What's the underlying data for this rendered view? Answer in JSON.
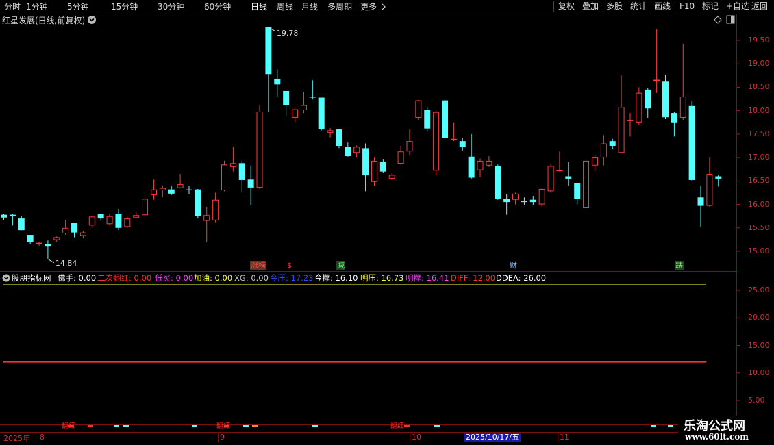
{
  "toolbar": {
    "periods": [
      "分时",
      "1分钟",
      "5分钟",
      "15分钟",
      "30分钟",
      "60分钟",
      "日线",
      "周线",
      "月线",
      "多周期",
      "更多"
    ],
    "active_period": "日线",
    "right_buttons": [
      "复权",
      "叠加",
      "多股",
      "统计",
      "画线",
      "F10",
      "标记",
      "+自选",
      "返回"
    ]
  },
  "chart_header": {
    "title": "红星发展(日线,前复权)"
  },
  "price_axis": {
    "ticks": [
      "19.50",
      "19.00",
      "18.50",
      "18.00",
      "17.50",
      "17.00",
      "16.50",
      "16.00",
      "15.50",
      "15.00"
    ]
  },
  "annotations": {
    "high_label": "19.78",
    "low_label": "14.84"
  },
  "signals": [
    {
      "text": "涨榜",
      "color": "#ff5050",
      "bg": "#663322"
    },
    {
      "text": "$",
      "color": "#ff3030",
      "bg": ""
    },
    {
      "text": "减",
      "color": "#60ff60",
      "bg": "#224422"
    },
    {
      "text": "财",
      "color": "#80c0ff",
      "bg": ""
    },
    {
      "text": "跌",
      "color": "#60ff60",
      "bg": "#224422"
    }
  ],
  "indicator": {
    "name": "股朋指标网",
    "items": [
      {
        "label": "佛手",
        "value": "0.00",
        "color": "#ffffff"
      },
      {
        "label": "二次翻红",
        "value": "0.00",
        "color": "#ff3030"
      },
      {
        "label": "低买",
        "value": "0.00",
        "color": "#ff40ff"
      },
      {
        "label": "加油",
        "value": "0.00",
        "color": "#ffff40"
      },
      {
        "label": "XG",
        "value": "0.00",
        "color": "#c8c8c8"
      },
      {
        "label": "今压",
        "value": "17.23",
        "color": "#3050ff"
      },
      {
        "label": "今撑",
        "value": "16.10",
        "color": "#ffffff"
      },
      {
        "label": "明压",
        "value": "16.73",
        "color": "#ffff40"
      },
      {
        "label": "明撑",
        "value": "16.41",
        "color": "#ff40ff"
      },
      {
        "label": "DIFF",
        "value": "12.00",
        "color": "#ff3030"
      },
      {
        "label": "DDEA",
        "value": "26.00",
        "color": "#ffffff"
      }
    ],
    "axis_ticks": [
      "25.00",
      "20.00",
      "15.00",
      "10.00",
      "5.00"
    ]
  },
  "markers": {
    "fanhong_label": "翻红"
  },
  "date_axis": {
    "year_label": "2025年",
    "months": [
      "8",
      "9",
      "10",
      "11"
    ],
    "cursor_date": "2025/10/17/五"
  },
  "watermark": {
    "line1": "乐淘公式网",
    "line2": "www.60lt.com"
  },
  "colors": {
    "up": "#ff3c3c",
    "down": "#54ffff",
    "axis": "#b01818",
    "background": "#000000"
  },
  "chart_data": {
    "type": "candlestick",
    "title": "红星发展(日线,前复权)",
    "ylim": [
      14.75,
      19.75
    ],
    "candles": [
      {
        "o": 15.78,
        "c": 15.72,
        "h": 15.8,
        "l": 15.66
      },
      {
        "o": 15.78,
        "c": 15.75,
        "h": 15.8,
        "l": 15.55
      },
      {
        "o": 15.7,
        "c": 15.45,
        "h": 15.75,
        "l": 15.45
      },
      {
        "o": 15.35,
        "c": 15.2,
        "h": 15.35,
        "l": 15.15
      },
      {
        "o": 15.16,
        "c": 15.18,
        "h": 15.2,
        "l": 15.1
      },
      {
        "o": 15.15,
        "c": 15.1,
        "h": 15.23,
        "l": 14.84
      },
      {
        "o": 15.24,
        "c": 15.3,
        "h": 15.32,
        "l": 15.2
      },
      {
        "o": 15.38,
        "c": 15.5,
        "h": 15.67,
        "l": 15.35
      },
      {
        "o": 15.6,
        "c": 15.4,
        "h": 15.6,
        "l": 15.3
      },
      {
        "o": 15.33,
        "c": 15.4,
        "h": 15.43,
        "l": 15.28
      },
      {
        "o": 15.55,
        "c": 15.74,
        "h": 15.75,
        "l": 15.5
      },
      {
        "o": 15.8,
        "c": 15.7,
        "h": 15.8,
        "l": 15.65
      },
      {
        "o": 15.58,
        "c": 15.75,
        "h": 15.8,
        "l": 15.55
      },
      {
        "o": 15.8,
        "c": 15.5,
        "h": 15.9,
        "l": 15.45
      },
      {
        "o": 15.52,
        "c": 15.7,
        "h": 15.74,
        "l": 15.5
      },
      {
        "o": 15.72,
        "c": 15.77,
        "h": 15.83,
        "l": 15.7
      },
      {
        "o": 15.77,
        "c": 16.12,
        "h": 16.18,
        "l": 15.7
      },
      {
        "o": 16.2,
        "c": 16.32,
        "h": 16.53,
        "l": 16.1
      },
      {
        "o": 16.3,
        "c": 16.35,
        "h": 16.4,
        "l": 16.15
      },
      {
        "o": 16.32,
        "c": 16.23,
        "h": 16.4,
        "l": 16.2
      },
      {
        "o": 16.35,
        "c": 16.43,
        "h": 16.65,
        "l": 16.34
      },
      {
        "o": 16.32,
        "c": 16.31,
        "h": 16.4,
        "l": 16.22
      },
      {
        "o": 16.32,
        "c": 15.75,
        "h": 16.33,
        "l": 15.7
      },
      {
        "o": 15.65,
        "c": 15.77,
        "h": 15.95,
        "l": 15.19
      },
      {
        "o": 15.66,
        "c": 16.1,
        "h": 16.25,
        "l": 15.62
      },
      {
        "o": 16.3,
        "c": 16.85,
        "h": 16.93,
        "l": 16.28
      },
      {
        "o": 16.8,
        "c": 16.88,
        "h": 17.22,
        "l": 16.7
      },
      {
        "o": 16.88,
        "c": 16.52,
        "h": 16.93,
        "l": 16.25
      },
      {
        "o": 16.53,
        "c": 16.36,
        "h": 16.83,
        "l": 15.98
      },
      {
        "o": 16.36,
        "c": 17.98,
        "h": 18.12,
        "l": 16.33
      },
      {
        "o": 19.78,
        "c": 18.78,
        "h": 19.78,
        "l": 17.98
      },
      {
        "o": 18.67,
        "c": 18.56,
        "h": 18.88,
        "l": 18.3
      },
      {
        "o": 18.42,
        "c": 18.12,
        "h": 18.42,
        "l": 17.88
      },
      {
        "o": 17.85,
        "c": 18.03,
        "h": 18.05,
        "l": 17.75
      },
      {
        "o": 18.01,
        "c": 18.12,
        "h": 18.4,
        "l": 17.95
      },
      {
        "o": 18.3,
        "c": 18.28,
        "h": 18.65,
        "l": 18.24
      },
      {
        "o": 18.28,
        "c": 17.6,
        "h": 18.28,
        "l": 17.58
      },
      {
        "o": 17.53,
        "c": 17.58,
        "h": 17.63,
        "l": 17.43
      },
      {
        "o": 17.6,
        "c": 17.25,
        "h": 17.6,
        "l": 17.2
      },
      {
        "o": 17.23,
        "c": 17.03,
        "h": 17.32,
        "l": 17.02
      },
      {
        "o": 17.1,
        "c": 17.23,
        "h": 17.26,
        "l": 17.0
      },
      {
        "o": 17.2,
        "c": 16.62,
        "h": 17.3,
        "l": 16.28
      },
      {
        "o": 16.48,
        "c": 16.93,
        "h": 17.0,
        "l": 16.4
      },
      {
        "o": 16.9,
        "c": 16.7,
        "h": 16.97,
        "l": 16.68
      },
      {
        "o": 16.55,
        "c": 16.63,
        "h": 16.66,
        "l": 16.52
      },
      {
        "o": 16.87,
        "c": 17.13,
        "h": 17.25,
        "l": 16.85
      },
      {
        "o": 17.13,
        "c": 17.35,
        "h": 17.6,
        "l": 17.05
      },
      {
        "o": 17.85,
        "c": 18.22,
        "h": 18.23,
        "l": 17.8
      },
      {
        "o": 18.02,
        "c": 17.62,
        "h": 18.08,
        "l": 17.55
      },
      {
        "o": 16.72,
        "c": 17.97,
        "h": 18.0,
        "l": 16.62
      },
      {
        "o": 18.22,
        "c": 17.42,
        "h": 18.24,
        "l": 17.33
      },
      {
        "o": 17.4,
        "c": 17.4,
        "h": 17.75,
        "l": 17.35
      },
      {
        "o": 17.35,
        "c": 17.22,
        "h": 17.42,
        "l": 17.15
      },
      {
        "o": 17.02,
        "c": 16.57,
        "h": 17.5,
        "l": 16.55
      },
      {
        "o": 16.73,
        "c": 16.93,
        "h": 16.98,
        "l": 16.58
      },
      {
        "o": 16.83,
        "c": 16.93,
        "h": 17.03,
        "l": 16.8
      },
      {
        "o": 16.82,
        "c": 16.12,
        "h": 16.85,
        "l": 16.1
      },
      {
        "o": 16.12,
        "c": 16.05,
        "h": 16.22,
        "l": 15.78
      },
      {
        "o": 16.1,
        "c": 16.23,
        "h": 16.25,
        "l": 16.0
      },
      {
        "o": 16.07,
        "c": 16.05,
        "h": 16.15,
        "l": 15.99
      },
      {
        "o": 16.1,
        "c": 16.05,
        "h": 16.17,
        "l": 15.99
      },
      {
        "o": 16.0,
        "c": 16.33,
        "h": 16.35,
        "l": 15.95
      },
      {
        "o": 16.28,
        "c": 16.82,
        "h": 16.85,
        "l": 16.25
      },
      {
        "o": 16.73,
        "c": 16.73,
        "h": 17.13,
        "l": 16.7
      },
      {
        "o": 16.6,
        "c": 16.55,
        "h": 16.9,
        "l": 16.4
      },
      {
        "o": 16.45,
        "c": 16.12,
        "h": 16.45,
        "l": 16.0
      },
      {
        "o": 15.92,
        "c": 16.93,
        "h": 16.95,
        "l": 15.9
      },
      {
        "o": 16.83,
        "c": 17.0,
        "h": 17.05,
        "l": 16.7
      },
      {
        "o": 17.0,
        "c": 17.3,
        "h": 17.48,
        "l": 16.83
      },
      {
        "o": 17.35,
        "c": 17.25,
        "h": 17.4,
        "l": 17.18
      },
      {
        "o": 17.1,
        "c": 18.08,
        "h": 18.75,
        "l": 17.1
      },
      {
        "o": 17.8,
        "c": 17.8,
        "h": 17.95,
        "l": 17.45
      },
      {
        "o": 17.75,
        "c": 18.38,
        "h": 18.5,
        "l": 17.7
      },
      {
        "o": 18.45,
        "c": 18.05,
        "h": 18.48,
        "l": 17.85
      },
      {
        "o": 18.66,
        "c": 18.66,
        "h": 19.74,
        "l": 18.38
      },
      {
        "o": 18.62,
        "c": 17.86,
        "h": 18.77,
        "l": 17.82
      },
      {
        "o": 17.95,
        "c": 17.75,
        "h": 17.97,
        "l": 17.45
      },
      {
        "o": 17.85,
        "c": 18.3,
        "h": 19.43,
        "l": 17.8
      },
      {
        "o": 18.1,
        "c": 16.52,
        "h": 18.2,
        "l": 16.5
      },
      {
        "o": 16.15,
        "c": 15.97,
        "h": 16.4,
        "l": 15.52
      },
      {
        "o": 15.97,
        "c": 16.65,
        "h": 17.0,
        "l": 15.95
      },
      {
        "o": 16.6,
        "c": 16.55,
        "h": 16.63,
        "l": 16.38
      }
    ],
    "indicator_lines": [
      {
        "name": "DIFF",
        "value": 12.0,
        "color": "#ff3030"
      },
      {
        "name": "DDEA",
        "value": 26.0,
        "color": "#ffff40"
      }
    ],
    "indicator_ylim": [
      3,
      30.5
    ]
  }
}
